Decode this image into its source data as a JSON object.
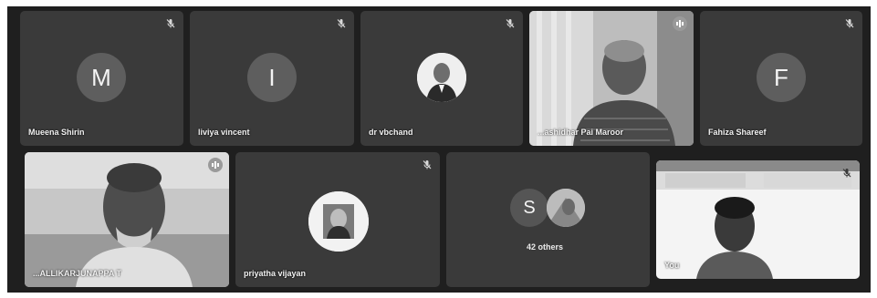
{
  "participants_row1": [
    {
      "name": "Mueena Shirin",
      "initial": "M",
      "mic": "mic-off-icon"
    },
    {
      "name": "liviya vincent",
      "initial": "I",
      "mic": "mic-off-icon"
    },
    {
      "name": "dr vbchand",
      "mic": "mic-off-icon"
    },
    {
      "name": "...ashidhar Pai Maroor",
      "mic": "speaking-indicator"
    },
    {
      "name": "Fahiza Shareef",
      "initial": "F",
      "mic": "mic-off-icon"
    }
  ],
  "participants_row2": [
    {
      "name": "...ALLIKARJUNAPPA T",
      "mic": "speaking-indicator"
    },
    {
      "name": "priyatha vijayan",
      "mic": "mic-off-icon"
    },
    {
      "name": "",
      "initial": "S",
      "others_label": "42 others"
    },
    {
      "name": "You",
      "mic": "mic-off-icon"
    }
  ],
  "colors": {
    "stage": "#1f1f1f",
    "tile": "#3a3a3a",
    "avatar": "#5e5e5e"
  }
}
